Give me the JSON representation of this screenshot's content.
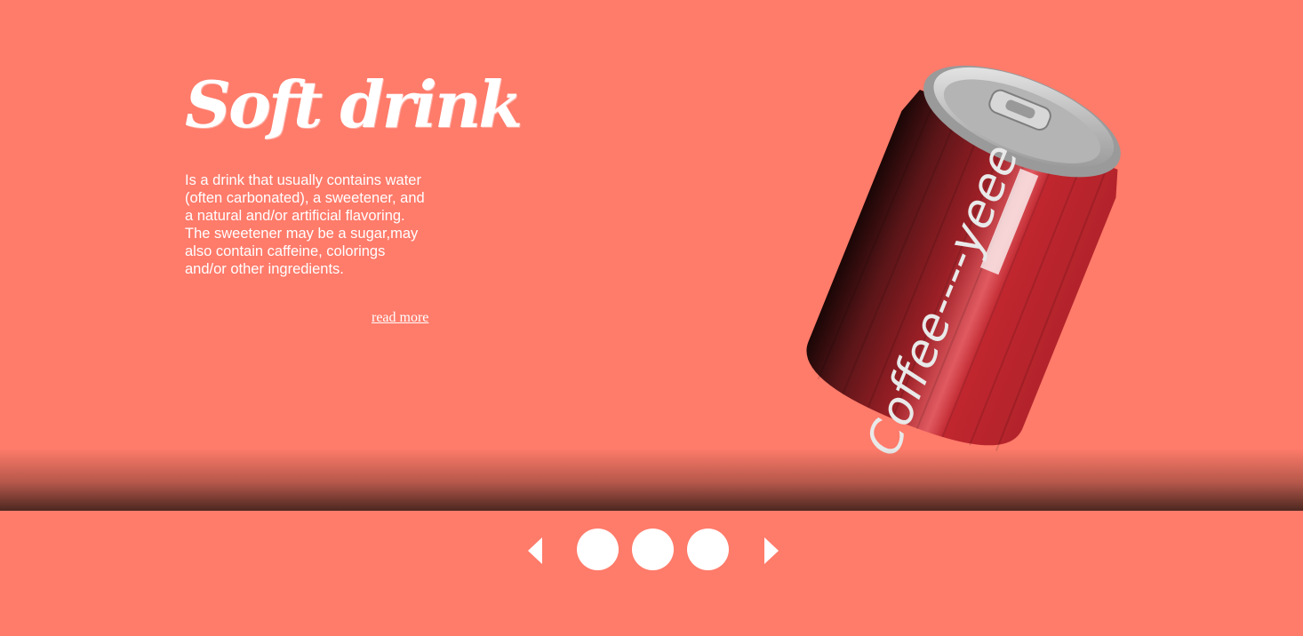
{
  "hero": {
    "title": "Soft drink",
    "description": "Is a drink that usually contains water (often carbonated), a sweetener, and a natural and/or artificial flavoring. The sweetener may be a sugar,may also contain caffeine, colorings and/or other ingredients.",
    "read_more_label": "read more",
    "can_label": "Coffee----yeee"
  },
  "colors": {
    "background": "#ff7b6a",
    "can_red": "#b8222b",
    "can_lid": "#c9c9c9",
    "text": "#ffffff"
  },
  "carousel": {
    "prev_icon": "triangle-left-icon",
    "next_icon": "triangle-right-icon",
    "dots": [
      {
        "name": "slide-1"
      },
      {
        "name": "slide-2"
      },
      {
        "name": "slide-3"
      }
    ]
  }
}
